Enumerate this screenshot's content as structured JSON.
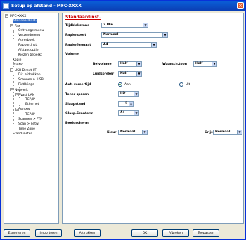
{
  "window": {
    "title": "Setup op afstand - MFC-XXXX"
  },
  "tree": {
    "items": [
      {
        "label": "MFC-XXXX",
        "expander": "−"
      },
      {
        "label": "Standaardinst.",
        "selected": true
      },
      {
        "label": "Fax",
        "expander": "−"
      },
      {
        "label": "Ontvangstmenu"
      },
      {
        "label": "Verzendmenu"
      },
      {
        "label": "Adresboek"
      },
      {
        "label": "Rapportinst."
      },
      {
        "label": "Afstandoptie"
      },
      {
        "label": "Kiezen beperkt"
      },
      {
        "label": "Kopie"
      },
      {
        "label": "Printer"
      },
      {
        "label": "USB Direct I/F",
        "expander": "−"
      },
      {
        "label": "Dir. afdrukken"
      },
      {
        "label": "Scannen n. USB"
      },
      {
        "label": "PictBridge"
      },
      {
        "label": "Netwerk",
        "expander": "−"
      },
      {
        "label": "Vast LAN",
        "expander": "−"
      },
      {
        "label": "TCP/IP"
      },
      {
        "label": "Ethernet"
      },
      {
        "label": "WLAN",
        "expander": "−"
      },
      {
        "label": "TCP/IP"
      },
      {
        "label": "Scannen > FTP"
      },
      {
        "label": "Scan > netw."
      },
      {
        "label": "Time Zone"
      },
      {
        "label": "Stand.instel."
      }
    ]
  },
  "panel": {
    "title": "Standaardinst.",
    "fields": {
      "tijdklokstand": {
        "label": "Tijdklokstand",
        "value": "2 Min"
      },
      "papiersoort": {
        "label": "Papiersoort",
        "value": "Normaal"
      },
      "papierformaat": {
        "label": "Papierformaat",
        "value": "A4"
      },
      "volume": {
        "label": "Volume"
      },
      "belvolume": {
        "label": "Belvolume",
        "value": "Half"
      },
      "waarschtoon": {
        "label": "Waarsch.toon",
        "value": "Half"
      },
      "luidspreker": {
        "label": "Luidspreker",
        "value": "Half"
      },
      "aut_zomertijd": {
        "label": "Aut. zomertijd",
        "on": "Aan",
        "off": "Uit"
      },
      "toner_sparen": {
        "label": "Toner sparen",
        "value": "Uit"
      },
      "slaapstand": {
        "label": "Slaapstand",
        "value": "5"
      },
      "glasplformaat": {
        "label": "Glasp.Scanform",
        "value": "A4"
      },
      "beeldscherm": {
        "label": "Beeldscherm"
      },
      "kleur": {
        "label": "Kleur",
        "value": "Normaal"
      },
      "grijs": {
        "label": "Grijs",
        "value": "Normaal"
      }
    }
  },
  "buttons": {
    "export": "Exporteren",
    "import": "Importeren",
    "print": "Afdrukken",
    "ok": "OK",
    "cancel": "Afbreken",
    "apply": "Toepassen"
  },
  "colors": {
    "title_accent": "#cc0000",
    "selection": "#316ac5",
    "titlebar": "#0a5fd8"
  }
}
